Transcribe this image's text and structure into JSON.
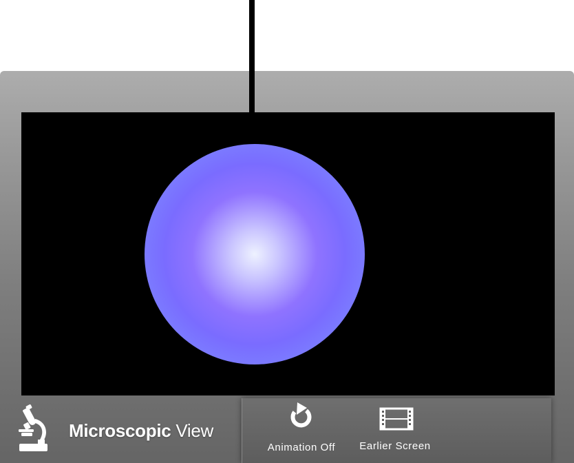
{
  "view": {
    "title_bold": "Microscopic",
    "title_rest": " View",
    "microscope_icon": "microscope-icon"
  },
  "controls": {
    "animation": {
      "label": "Animation Off",
      "icon": "refresh-icon"
    },
    "earlier_screen": {
      "label": "Earlier Screen",
      "icon": "film-strip-icon"
    }
  },
  "colors": {
    "frame_top": "#adadad",
    "frame_bottom": "#656565",
    "viewport_background": "#000000",
    "particle_edge": "#8496ff",
    "particle_mid": "#8f73ff",
    "particle_center": "#eef2ff",
    "text": "#ffffff"
  }
}
